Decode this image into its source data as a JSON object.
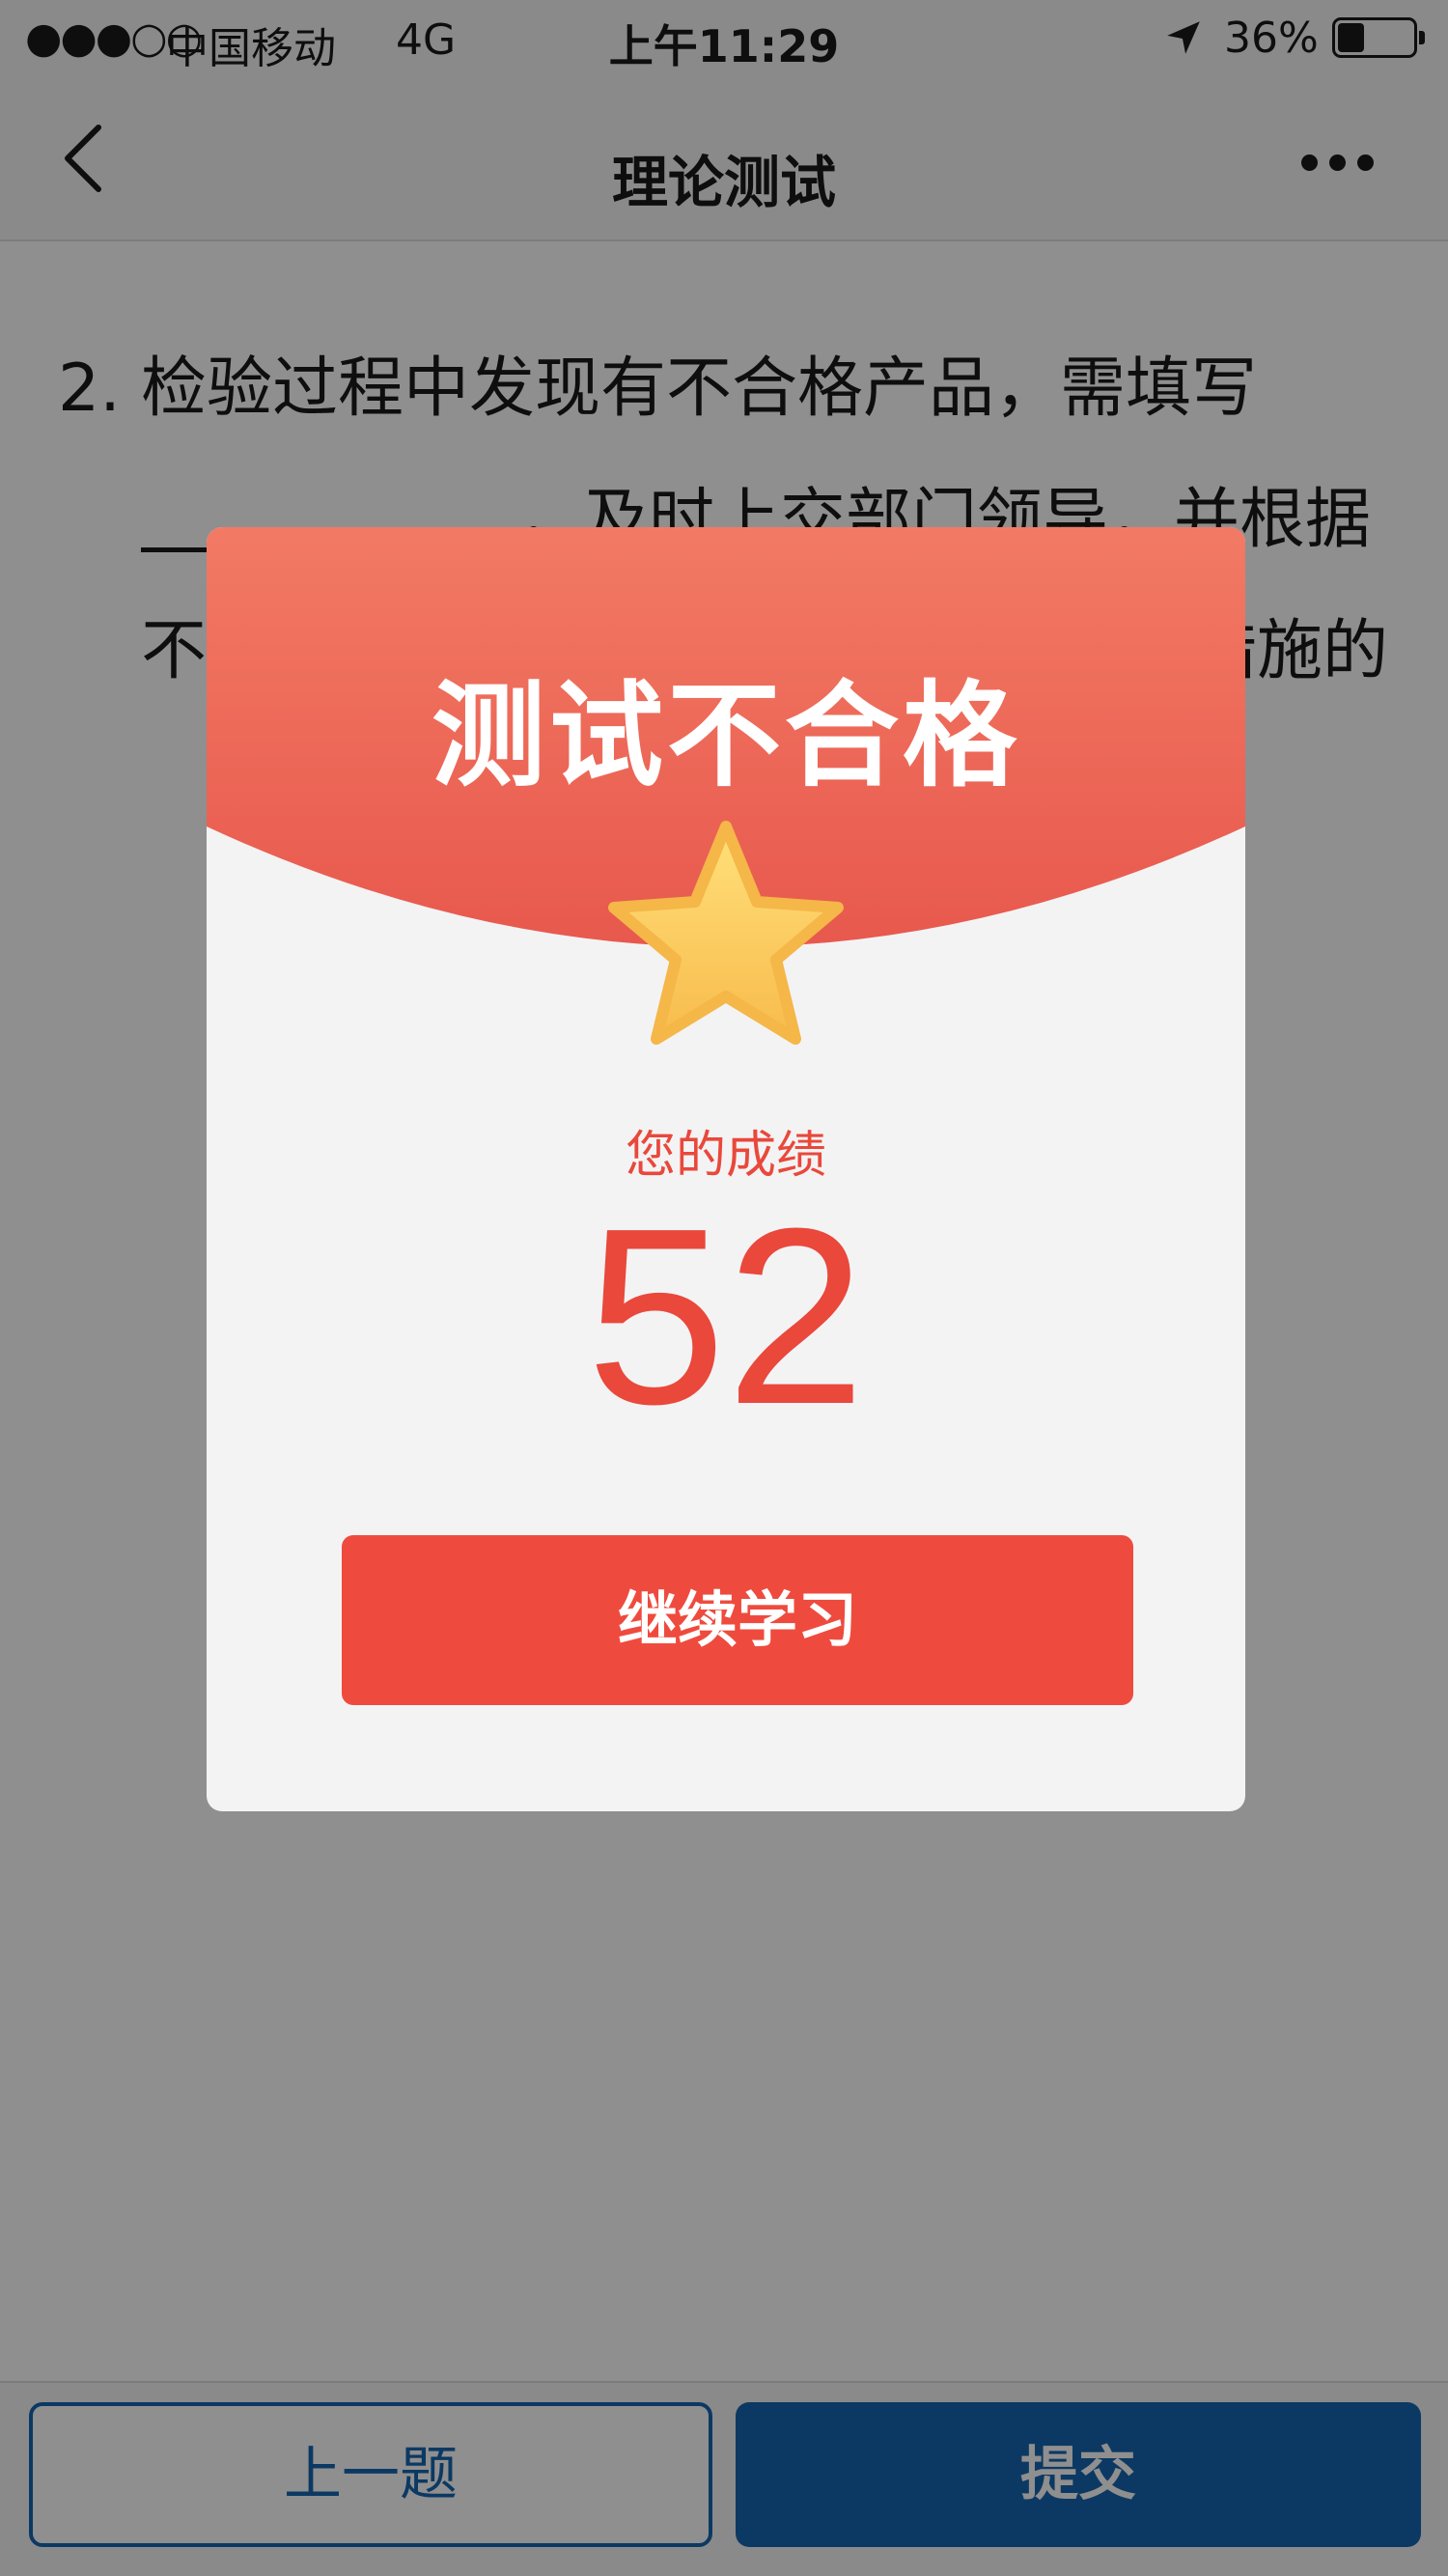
{
  "status_bar": {
    "signal": "●●●○○",
    "carrier": "中国移动",
    "network": "4G",
    "time": "上午11:29",
    "battery_text": "36%",
    "battery_level": 0.36,
    "location_icon": "location-arrow-icon"
  },
  "nav": {
    "title": "理论测试",
    "back_icon": "chevron-left-icon",
    "more_icon": "more-dots-icon"
  },
  "question": {
    "number": "2.",
    "text_before": "检验过程中发现有不合格产品，需填写",
    "text_after": "，及时上交部门领导，并根据不合格产品的情况，制定相应的纠正措施的"
  },
  "modal": {
    "title": "测试不合格",
    "star_icon": "star-icon",
    "score_label": "您的成绩",
    "score": "52",
    "continue_label": "继续学习",
    "colors": {
      "header_top": "#f27a64",
      "header_bottom": "#e8584d",
      "accent": "#ee4b3e",
      "star": "#fbc85a"
    }
  },
  "bottom": {
    "prev_label": "上一题",
    "submit_label": "提交",
    "accent": "#1767b1"
  }
}
